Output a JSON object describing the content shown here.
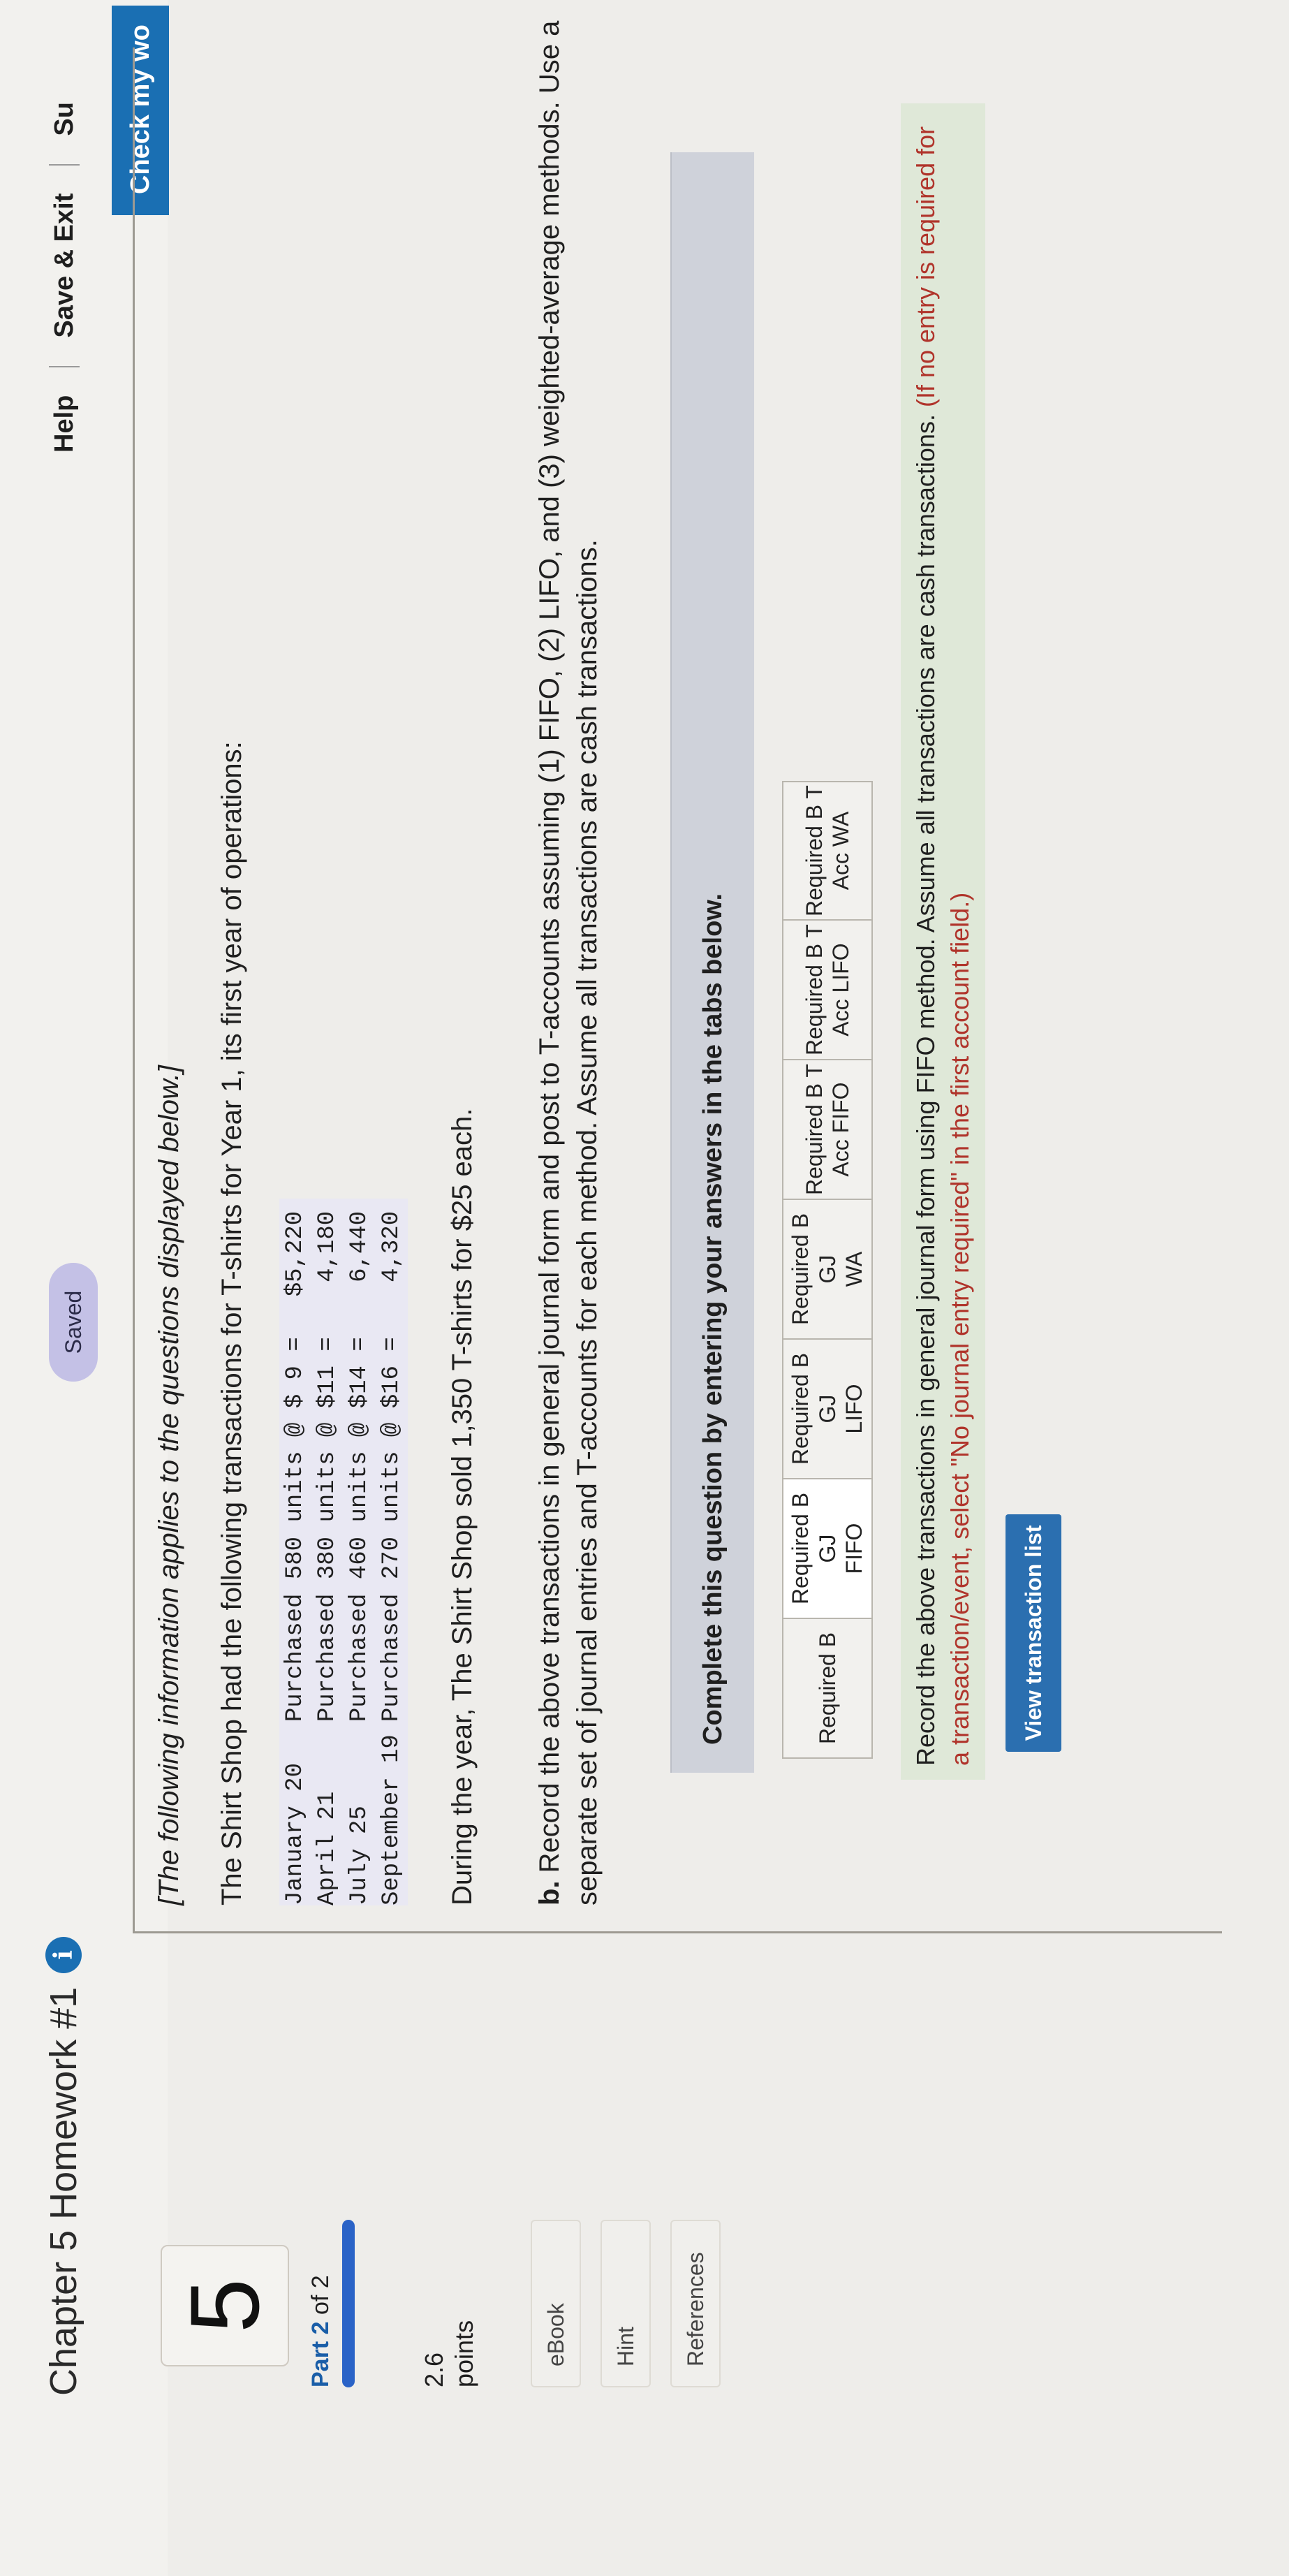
{
  "header": {
    "title": "Chapter 5 Homework #1",
    "info_badge": "i",
    "saved": "Saved",
    "help": "Help",
    "save_exit": "Save & Exit",
    "submit": "Su",
    "check": "Check my wo"
  },
  "sidebar": {
    "question_number": "5",
    "part_prefix": "Part",
    "part_num": "2",
    "part_suffix": "of 2",
    "points_value": "2.6",
    "points_label": "points",
    "ebook": "eBook",
    "hint": "Hint",
    "references": "References"
  },
  "content": {
    "intro_italic": "[The following information applies to the questions displayed below.]",
    "intro_line": "The Shirt Shop had the following transactions for T-shirts for Year 1, its first year of operations:",
    "transactions": [
      {
        "date": "January 20",
        "desc": "Purchased 580 units @ $ 9 =",
        "amount": "$5,220"
      },
      {
        "date": "April 21",
        "desc": "Purchased 380 units @ $11 =",
        "amount": "4,180"
      },
      {
        "date": "July 25",
        "desc": "Purchased 460 units @ $14 =",
        "amount": "6,440"
      },
      {
        "date": "September 19",
        "desc": "Purchased 270 units @ $16 =",
        "amount": "4,320"
      }
    ],
    "sold_line": "During the year, The Shirt Shop sold 1,350 T-shirts for $25 each.",
    "instr_bold": "b.",
    "instr_text": " Record the above transactions in general journal form and post to T-accounts assuming (1) FIFO, (2) LIFO, and (3) weighted-average methods. Use a separate set of journal entries and T-accounts for each method. Assume all transactions are cash transactions.",
    "complete_banner": "Complete this question by entering your answers in the tabs below.",
    "tabs": [
      {
        "line1": "Required B",
        "line2": ""
      },
      {
        "line1": "Required B GJ",
        "line2": "FIFO"
      },
      {
        "line1": "Required B GJ",
        "line2": "LIFO"
      },
      {
        "line1": "Required B GJ",
        "line2": "WA"
      },
      {
        "line1": "Required B T",
        "line2": "Acc FIFO"
      },
      {
        "line1": "Required B T",
        "line2": "Acc LIFO"
      },
      {
        "line1": "Required B T",
        "line2": "Acc WA"
      }
    ],
    "tab_note_main": "Record the above transactions in general journal form using FIFO method. Assume all transactions are cash transactions.",
    "tab_note_red": " (If no entry is required for a transaction/event, select \"No journal entry required\" in the first account field.)",
    "view_transaction_list": "View transaction list"
  }
}
